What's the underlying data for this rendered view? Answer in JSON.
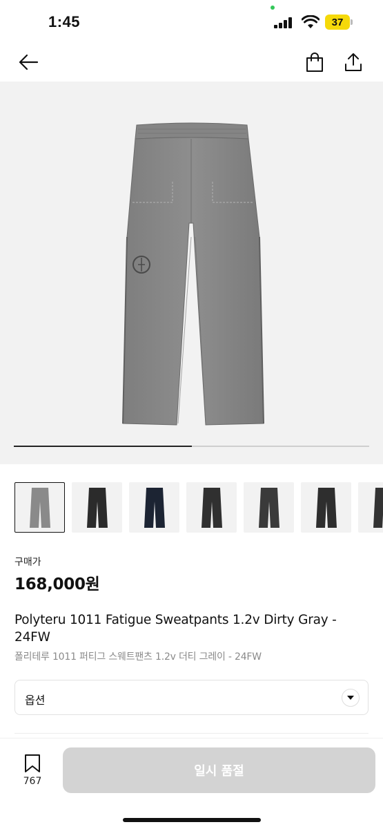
{
  "status_bar": {
    "time": "1:45",
    "battery": "37"
  },
  "nav": {
    "back_icon": "arrow-left-icon",
    "bag_icon": "shopping-bag-icon",
    "share_icon": "share-icon"
  },
  "hero": {
    "image": "gray-sweatpants-photo",
    "carousel_progress": 0.5
  },
  "thumbnails": [
    {
      "color": "#8a8a8a",
      "selected": true
    },
    {
      "color": "#2b2b2b",
      "selected": false
    },
    {
      "color": "#1c2433",
      "selected": false
    },
    {
      "color": "#303030",
      "selected": false
    },
    {
      "color": "#3a3a3a",
      "selected": false
    },
    {
      "color": "#2e2e2e",
      "selected": false
    },
    {
      "color": "#333333",
      "selected": false
    }
  ],
  "price": {
    "label": "구매가",
    "value": "168,000원"
  },
  "product": {
    "title_en": "Polyteru 1011 Fatigue Sweatpants 1.2v Dirty Gray - 24FW",
    "title_ko": "폴리테루 1011 퍼티그 스웨트팬츠 1.2v 더티 그레이 - 24FW"
  },
  "option": {
    "label": "옵션"
  },
  "bottom_bar": {
    "bookmark_count": "767",
    "buy_label": "일시 품절"
  },
  "colors": {
    "buy_disabled": "#d3d3d3",
    "hero_bg": "#f2f2f2",
    "battery": "#f5d90a"
  }
}
